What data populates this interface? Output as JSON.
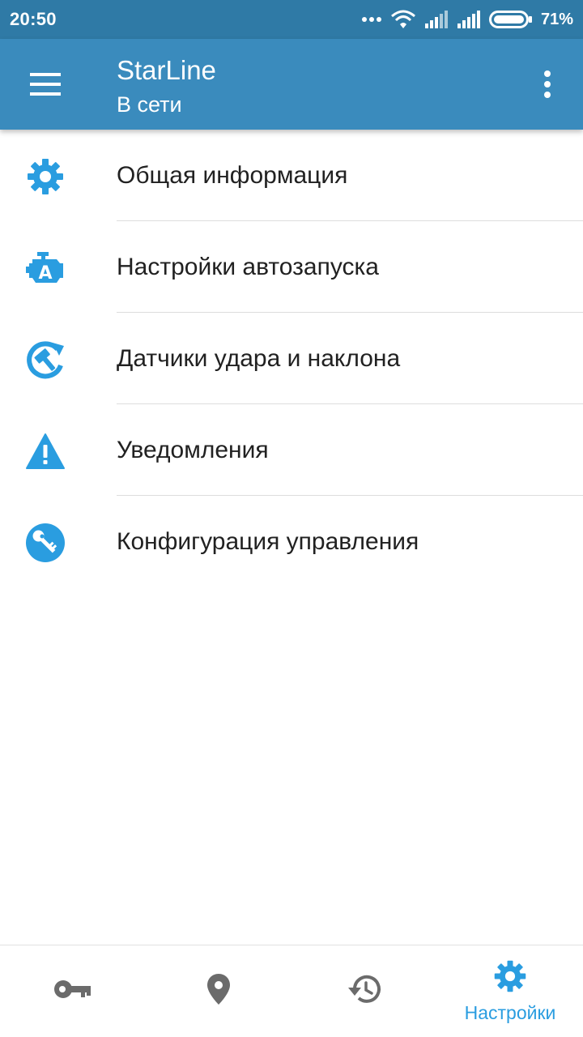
{
  "status_bar": {
    "time": "20:50",
    "battery_percent": "71%",
    "icons": [
      "dots-icon",
      "wifi-icon",
      "signal-icon",
      "signal-icon",
      "battery-icon"
    ]
  },
  "app_bar": {
    "title": "StarLine",
    "subtitle": "В сети",
    "background": "#3a8bbd"
  },
  "settings_list": {
    "items": [
      {
        "label": "Общая информация",
        "icon": "gear-icon"
      },
      {
        "label": "Настройки автозапуска",
        "icon": "engine-autostart-icon"
      },
      {
        "label": "Датчики удара и наклона",
        "icon": "shock-sensor-icon"
      },
      {
        "label": "Уведомления",
        "icon": "warning-icon"
      },
      {
        "label": "Конфигурация управления",
        "icon": "key-circle-icon"
      }
    ],
    "icon_color": "#2a9de0"
  },
  "bottom_nav": {
    "tabs": [
      {
        "icon": "key-icon",
        "label": ""
      },
      {
        "icon": "location-pin-icon",
        "label": ""
      },
      {
        "icon": "history-icon",
        "label": ""
      },
      {
        "icon": "gear-icon",
        "label": "Настройки",
        "active": true
      }
    ],
    "active_color": "#2a9de0",
    "inactive_color": "#6b6b6b"
  }
}
